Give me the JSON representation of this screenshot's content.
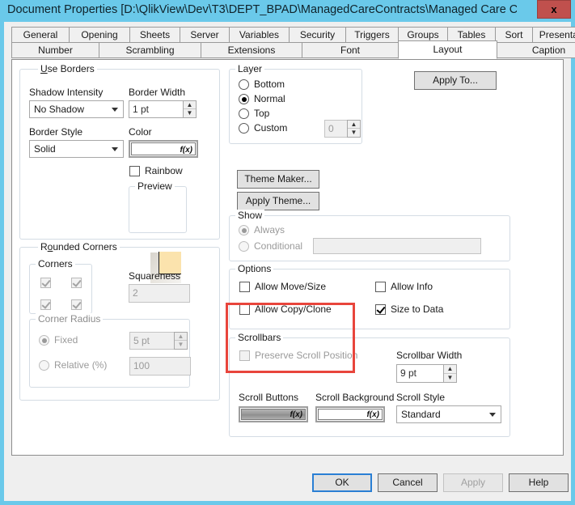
{
  "window": {
    "title": "Document Properties [D:\\QlikView\\Dev\\T3\\DEPT_BPAD\\ManagedCareContracts\\Managed Care Con...",
    "close_label": "x",
    "close_icon": "close-icon",
    "titlebar_color": "#6ac9ea",
    "close_button_color": "#c0504d"
  },
  "tabs": {
    "row1": [
      {
        "label": "General",
        "active": false
      },
      {
        "label": "Opening",
        "active": false
      },
      {
        "label": "Sheets",
        "active": false
      },
      {
        "label": "Server",
        "active": false
      },
      {
        "label": "Variables",
        "active": false
      },
      {
        "label": "Security",
        "active": false
      },
      {
        "label": "Triggers",
        "active": false
      },
      {
        "label": "Groups",
        "active": false
      },
      {
        "label": "Tables",
        "active": false
      },
      {
        "label": "Sort",
        "active": false
      },
      {
        "label": "Presentation",
        "active": false
      }
    ],
    "row2": [
      {
        "label": "Number",
        "active": false
      },
      {
        "label": "Scrambling",
        "active": false
      },
      {
        "label": "Extensions",
        "active": false
      },
      {
        "label": "Font",
        "active": false
      },
      {
        "label": "Layout",
        "active": true
      },
      {
        "label": "Caption",
        "active": false
      }
    ]
  },
  "borders": {
    "group_label": "Use Borders",
    "group_label_accel": "U",
    "group_label_rest": "se Borders",
    "checked": true,
    "shadow_intensity_label": "Shadow Intensity",
    "shadow_intensity_value": "No Shadow",
    "border_width_label": "Border Width",
    "border_width_value": "1 pt",
    "border_style_label": "Border Style",
    "border_style_value": "Solid",
    "color_label": "Color",
    "color_fx": "f(x)",
    "rainbow_label": "Rainbow",
    "rainbow_checked": false,
    "preview_label": "Preview",
    "preview_fill": "#fbe3ad"
  },
  "rounded": {
    "group_label": "Rounded Corners",
    "group_label_accel": "o",
    "checked": false,
    "corners_label": "Corners",
    "corners": [
      {
        "checked": true,
        "disabled": true
      },
      {
        "checked": true,
        "disabled": true
      },
      {
        "checked": true,
        "disabled": true
      },
      {
        "checked": true,
        "disabled": true
      }
    ],
    "squareness_label": "Squareness",
    "squareness_value": "2",
    "corner_radius_label": "Corner Radius",
    "fixed_label": "Fixed",
    "fixed_selected": true,
    "fixed_value": "5 pt",
    "relative_label": "Relative (%)",
    "relative_selected": false,
    "relative_value": "100"
  },
  "layer": {
    "group_label": "Layer",
    "options": [
      {
        "label": "Bottom",
        "selected": false
      },
      {
        "label": "Normal",
        "selected": true
      },
      {
        "label": "Top",
        "selected": false
      },
      {
        "label": "Custom",
        "selected": false
      }
    ],
    "custom_value": "0"
  },
  "theme": {
    "theme_maker_label": "Theme Maker...",
    "apply_theme_label": "Apply Theme..."
  },
  "apply_to": {
    "label": "Apply To..."
  },
  "show": {
    "group_label": "Show",
    "always_label": "Always",
    "always_selected": true,
    "conditional_label": "Conditional",
    "conditional_selected": false,
    "conditional_value": ""
  },
  "options": {
    "group_label": "Options",
    "allow_move_size_label": "Allow Move/Size",
    "allow_move_size_checked": false,
    "allow_copy_clone_label": "Allow Copy/Clone",
    "allow_copy_clone_checked": false,
    "allow_info_label": "Allow Info",
    "allow_info_checked": false,
    "size_to_data_label": "Size to Data",
    "size_to_data_checked": true,
    "highlight_color": "#e8453c"
  },
  "scrollbars": {
    "group_label": "Scrollbars",
    "preserve_scroll_label": "Preserve Scroll Position",
    "preserve_scroll_checked": false,
    "scrollbar_width_label": "Scrollbar Width",
    "scrollbar_width_value": "9 pt",
    "scroll_buttons_label": "Scroll Buttons",
    "scroll_buttons_fx": "f(x)",
    "scroll_background_label": "Scroll Background",
    "scroll_background_fx": "f(x)",
    "scroll_style_label": "Scroll Style",
    "scroll_style_value": "Standard"
  },
  "footer": {
    "ok_label": "OK",
    "cancel_label": "Cancel",
    "apply_label": "Apply",
    "apply_disabled": true,
    "help_label": "Help"
  }
}
